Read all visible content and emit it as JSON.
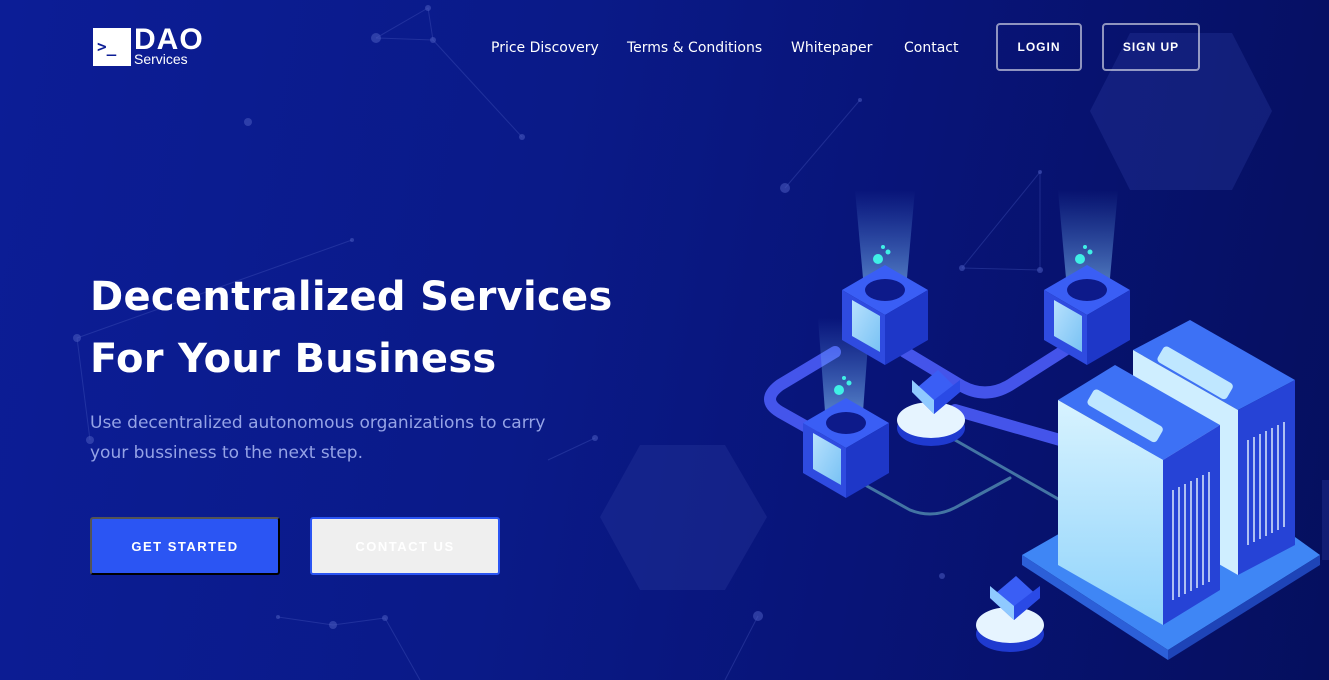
{
  "brand": {
    "mark": ">_",
    "name": "DAO",
    "tagline": "Services"
  },
  "nav": {
    "items": [
      {
        "label": "Price Discovery"
      },
      {
        "label": "Terms & Conditions"
      },
      {
        "label": "Whitepaper"
      },
      {
        "label": "Contact"
      }
    ],
    "login_label": "LOGIN",
    "signup_label": "SIGN UP"
  },
  "hero": {
    "title_line1": "Decentralized Services",
    "title_line2": "For Your Business",
    "subtitle_line1": "Use decentralized autonomous organizations to carry",
    "subtitle_line2": "your bussiness to the next step.",
    "primary_cta": "GET STARTED",
    "secondary_cta": "CONTACT US"
  },
  "colors": {
    "background": "#0c1d96",
    "accent": "#2b55f3",
    "subtitle": "#95a3e6"
  }
}
